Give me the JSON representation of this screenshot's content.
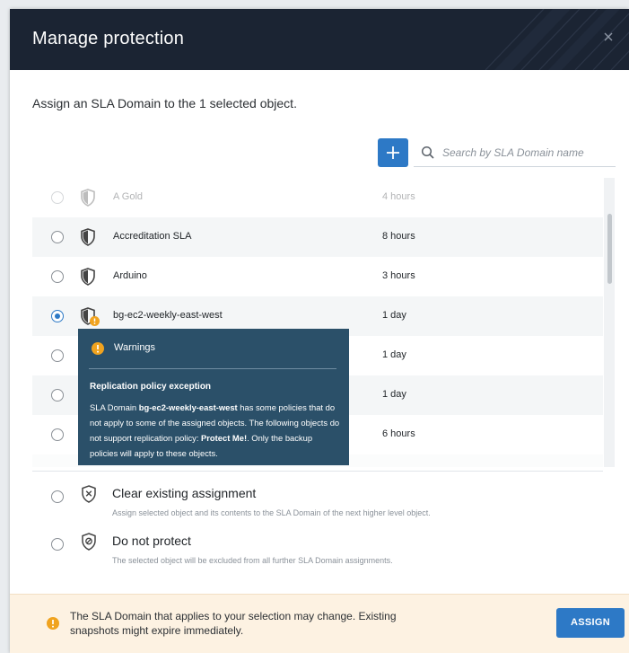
{
  "dialog": {
    "title": "Manage protection",
    "subtitle": "Assign an SLA Domain to the 1 selected object."
  },
  "search": {
    "placeholder": "Search by SLA Domain name"
  },
  "sla_list": [
    {
      "name": "A Gold",
      "frequency": "4 hours",
      "selected": false
    },
    {
      "name": "Accreditation SLA",
      "frequency": "8 hours",
      "selected": false
    },
    {
      "name": "Arduino",
      "frequency": "3 hours",
      "selected": false
    },
    {
      "name": "bg-ec2-weekly-east-west",
      "frequency": "1 day",
      "selected": true,
      "warning": true
    },
    {
      "name": "",
      "frequency": "1 day",
      "selected": false
    },
    {
      "name": "",
      "frequency": "1 day",
      "selected": false
    },
    {
      "name": "",
      "frequency": "6 hours",
      "selected": false
    }
  ],
  "tooltip": {
    "title": "Warnings",
    "heading": "Replication policy exception",
    "body_prefix": "SLA Domain ",
    "domain": "bg-ec2-weekly-east-west",
    "body_middle": " has some policies that do not apply to some of the assigned objects. The following objects do not support replication policy: ",
    "object": "Protect Me!",
    "body_suffix": ". Only the backup policies will apply to these objects."
  },
  "options": {
    "clear": {
      "title": "Clear existing assignment",
      "description": "Assign selected object and its contents to the SLA Domain of the next higher level object."
    },
    "donotprotect": {
      "title": "Do not protect",
      "description": "The selected object will be excluded from all further SLA Domain assignments."
    }
  },
  "footer": {
    "warning": "The SLA Domain that applies to your selection may change. Existing snapshots might expire immediately.",
    "assign_label": "ASSIGN"
  },
  "colors": {
    "header": "#1b2433",
    "accent": "#2d79c6",
    "tooltip": "#2b5069",
    "warning": "#f0a31f",
    "footer_bg": "#fdf2e2"
  },
  "icons": [
    "close-icon",
    "plus-icon",
    "search-icon",
    "shield-icon",
    "warning-icon",
    "clear-shield-icon",
    "no-protect-shield-icon"
  ]
}
